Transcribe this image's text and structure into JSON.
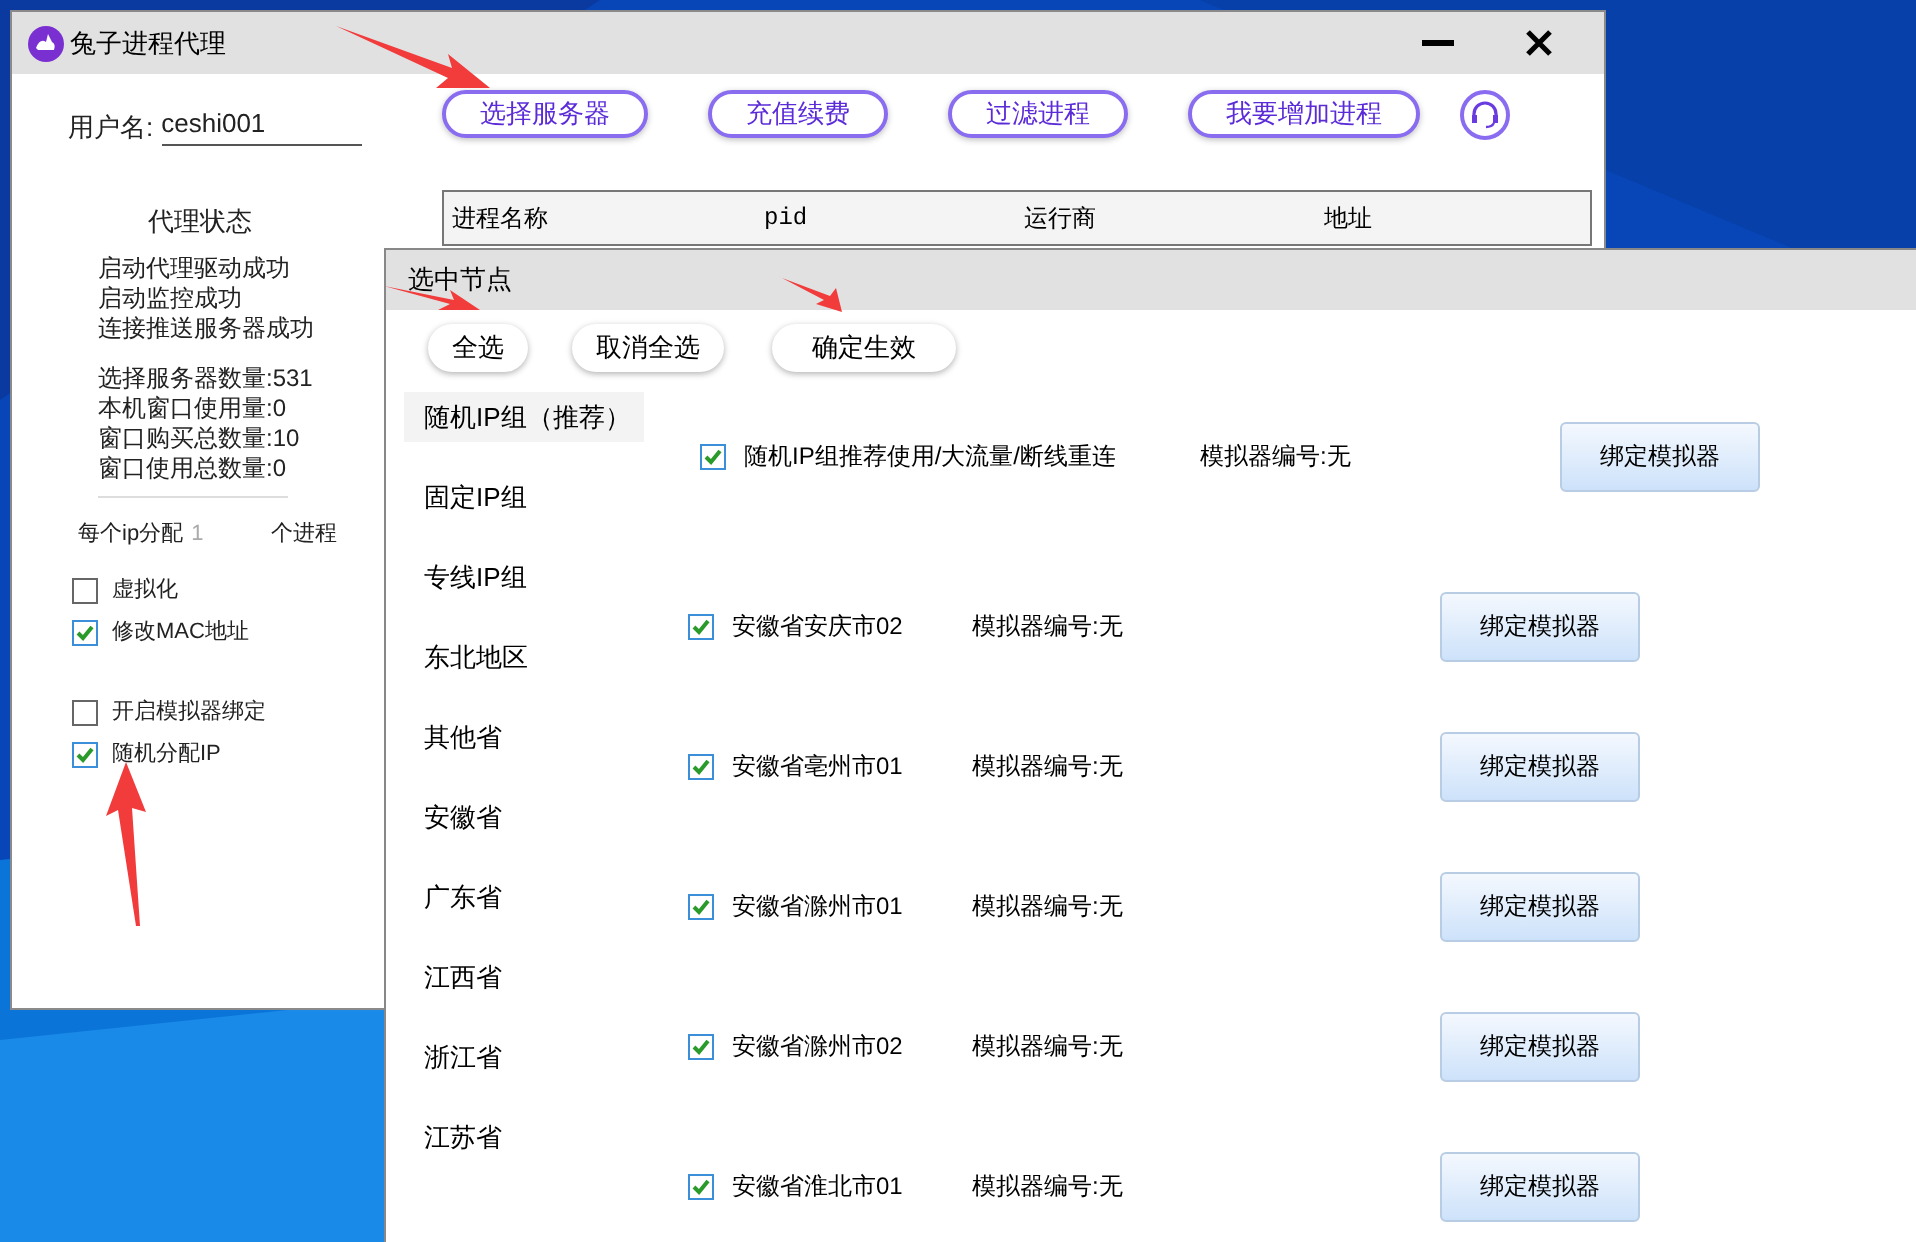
{
  "main_window": {
    "title": "兔子进程代理",
    "username_label": "用户名:",
    "username": "ceshi001",
    "buttons": [
      "选择服务器",
      "充值续费",
      "过滤进程",
      "我要增加进程"
    ],
    "table": {
      "columns": [
        "进程名称",
        "pid",
        "运行商",
        "地址"
      ]
    },
    "status_title": "代理状态",
    "status_lines": [
      "启动代理驱动成功",
      "启动监控成功",
      "连接推送服务器成功"
    ],
    "counts": [
      "选择服务器数量:531",
      "本机窗口使用量:0",
      "窗口购买总数量:10",
      "窗口使用总数量:0"
    ],
    "ip_alloc": {
      "prefix": "每个ip分配",
      "value": "1",
      "suffix": "个进程"
    },
    "options": [
      {
        "label": "虚拟化",
        "checked": false
      },
      {
        "label": "修改MAC地址",
        "checked": true
      },
      {
        "label": "开启模拟器绑定",
        "checked": false
      },
      {
        "label": "随机分配IP",
        "checked": true
      }
    ]
  },
  "dialog": {
    "title": "选中节点",
    "buttons": [
      "全选",
      "取消全选",
      "确定生效"
    ],
    "groups": [
      {
        "label": "随机IP组（推荐）",
        "selected": true
      },
      {
        "label": "固定IP组",
        "selected": false
      },
      {
        "label": "专线IP组",
        "selected": false
      },
      {
        "label": "东北地区",
        "selected": false
      },
      {
        "label": "其他省",
        "selected": false
      },
      {
        "label": "安徽省",
        "selected": false
      },
      {
        "label": "广东省",
        "selected": false
      },
      {
        "label": "江西省",
        "selected": false
      },
      {
        "label": "浙江省",
        "selected": false
      },
      {
        "label": "江苏省",
        "selected": false
      }
    ],
    "nodes": [
      {
        "name": "随机IP组推荐使用/大流量/断线重连",
        "checked": true,
        "simulator": "模拟器编号:无",
        "button": "绑定模拟器"
      },
      {
        "name": "安徽省安庆市02",
        "checked": true,
        "simulator": "模拟器编号:无",
        "button": "绑定模拟器"
      },
      {
        "name": "安徽省亳州市01",
        "checked": true,
        "simulator": "模拟器编号:无",
        "button": "绑定模拟器"
      },
      {
        "name": "安徽省滁州市01",
        "checked": true,
        "simulator": "模拟器编号:无",
        "button": "绑定模拟器"
      },
      {
        "name": "安徽省滁州市02",
        "checked": true,
        "simulator": "模拟器编号:无",
        "button": "绑定模拟器"
      },
      {
        "name": "安徽省淮北市01",
        "checked": true,
        "simulator": "模拟器编号:无",
        "button": "绑定模拟器"
      }
    ]
  }
}
